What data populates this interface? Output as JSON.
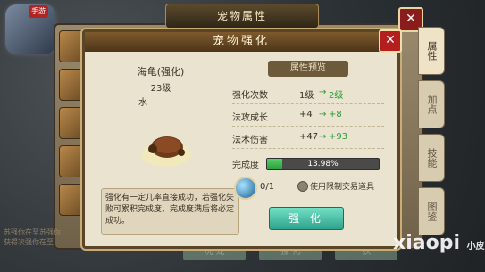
{
  "outer": {
    "title": "宠物属性",
    "side_tabs": [
      "属性",
      "加点",
      "技能",
      "图鉴"
    ],
    "bottom_buttons": [
      "洗 宠",
      "强 化",
      "妖"
    ],
    "left_text": "苏强你在至苏强你获得次强你在至"
  },
  "modal": {
    "title": "宠物强化",
    "pet_name": "海龟(强化)",
    "pet_level": "23级",
    "pet_element": "水",
    "preview_label": "属性预览",
    "attributes": [
      {
        "name": "强化次数",
        "current": "1级",
        "next": "2级"
      },
      {
        "name": "法攻成长",
        "current": "+4",
        "next": "+8"
      },
      {
        "name": "法术伤害",
        "current": "+47",
        "next": "+93"
      }
    ],
    "progress_label": "完成度",
    "progress_text": "13.98%",
    "progress_value": 0.1398,
    "item_count": "0/1",
    "checkbox_label": "使用限制交易道具",
    "description": "强化有一定几率直接成功，若强化失败可累积完成度，完成度满后将必定成功。",
    "confirm_label": "强 化"
  },
  "watermark": {
    "text": "xiaopi",
    "small": "小皮"
  },
  "colors": {
    "green": "#2a9a35",
    "confirm": "#4cc4aa",
    "close": "#b31e1e"
  }
}
